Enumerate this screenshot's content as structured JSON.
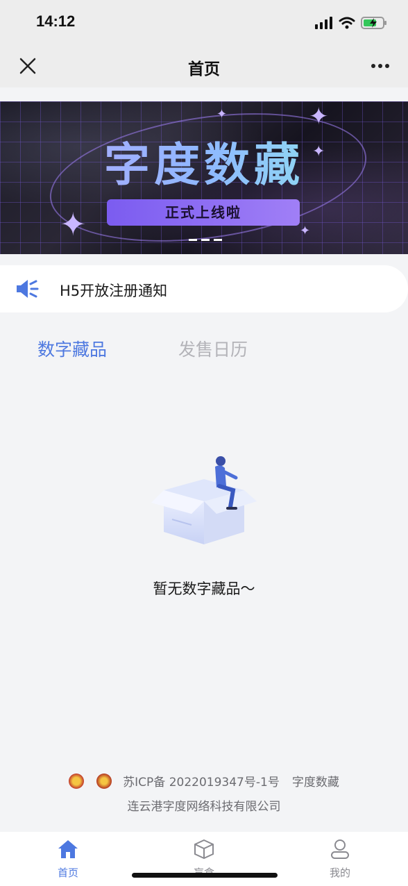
{
  "status_bar": {
    "time": "14:12"
  },
  "nav": {
    "title": "首页"
  },
  "banner": {
    "title": "字度数藏",
    "subtitle": "正式上线啦"
  },
  "notice": {
    "text": "H5开放注册通知"
  },
  "tabs": [
    {
      "label": "数字藏品",
      "active": true
    },
    {
      "label": "发售日历",
      "active": false
    }
  ],
  "empty_state": {
    "text": "暂无数字藏品～"
  },
  "footer": {
    "icp": "苏ICP备 2022019347号-1号",
    "brand": "字度数藏",
    "company": "连云港字度网络科技有限公司"
  },
  "tabbar": {
    "items": [
      {
        "label": "首页",
        "icon": "home-icon",
        "active": true
      },
      {
        "label": "盲盒",
        "icon": "box-icon",
        "active": false
      },
      {
        "label": "我的",
        "icon": "user-icon",
        "active": false
      }
    ]
  },
  "colors": {
    "accent": "#4d78e0",
    "inactive_tab": "#b3b3b8",
    "bar_bg": "#ededed",
    "page_bg": "#f3f4f6"
  }
}
